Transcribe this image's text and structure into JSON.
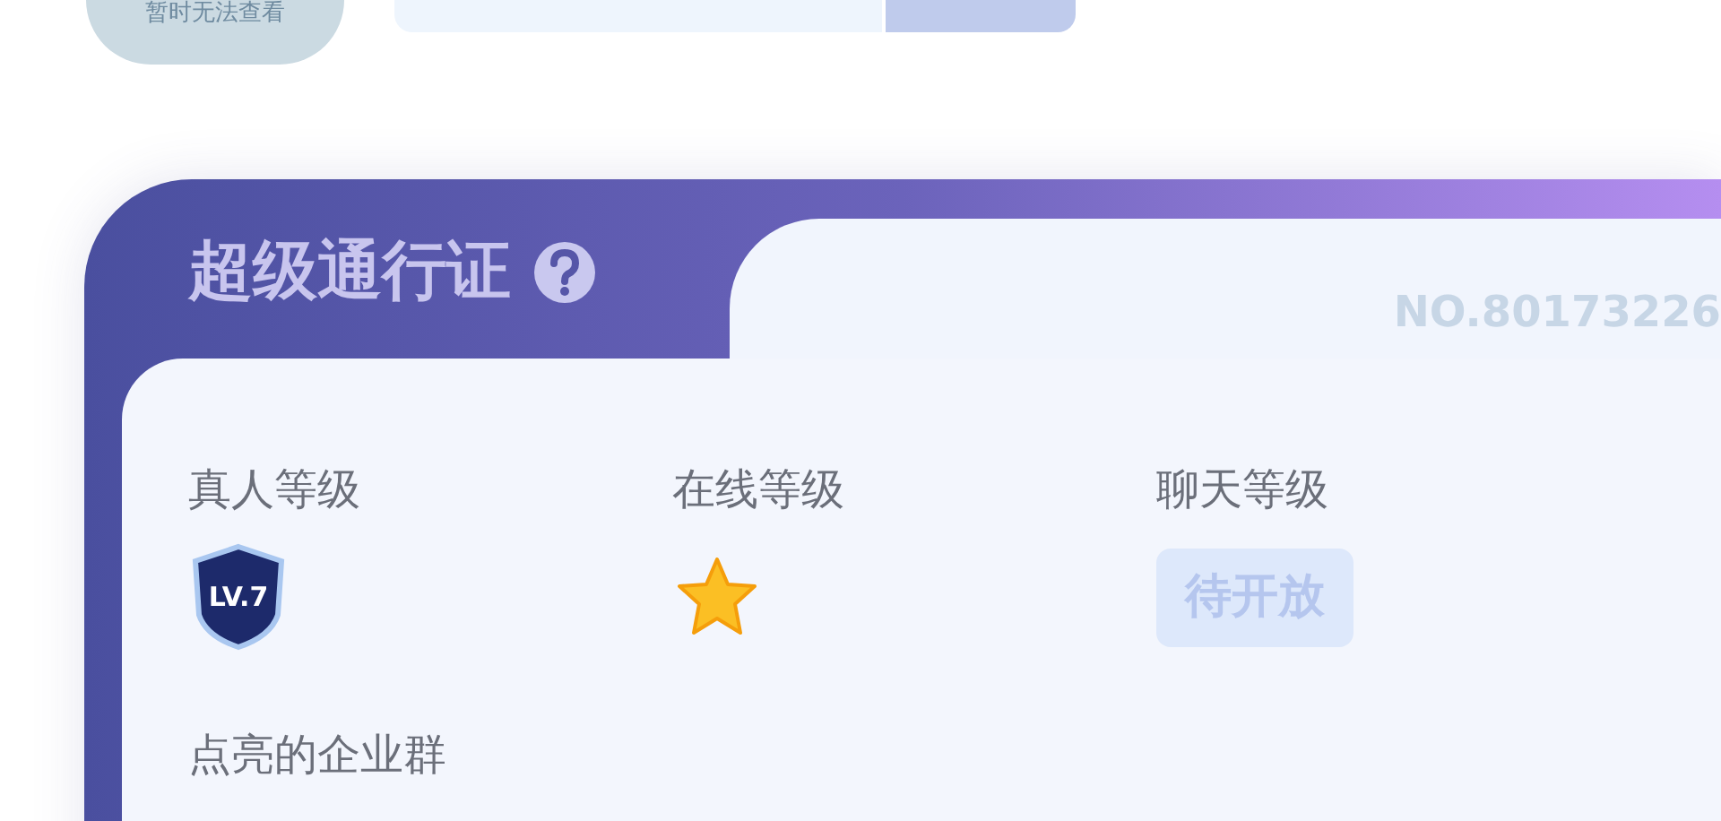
{
  "top": {
    "avatar_note": "暂时无法查看"
  },
  "pass": {
    "title": "超级通行证",
    "number": "NO.80173226",
    "levels": [
      {
        "label": "真人等级",
        "kind": "badge",
        "badge": "LV.7"
      },
      {
        "label": "在线等级",
        "kind": "star"
      },
      {
        "label": "聊天等级",
        "kind": "pending",
        "status": "待开放"
      }
    ],
    "groups_title": "点亮的企业群"
  }
}
